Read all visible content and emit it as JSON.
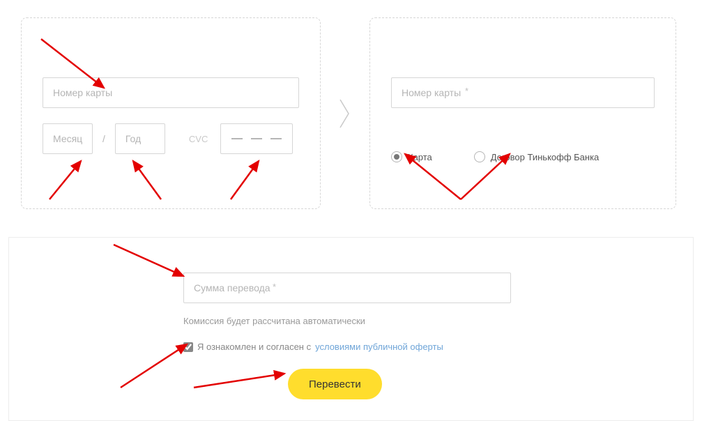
{
  "from_card": {
    "number_placeholder": "Номер карты",
    "month_placeholder": "Месяц",
    "year_placeholder": "Год",
    "cvc_label": "CVC"
  },
  "to_card": {
    "number_placeholder": "Номер карты",
    "radio_card": "Карта",
    "radio_contract": "Договор Тинькофф Банка",
    "selected": "card"
  },
  "transfer": {
    "amount_placeholder": "Сумма перевода",
    "commission_note": "Комиссия будет рассчитана автоматически",
    "consent_text": "Я ознакомлен и согласен с ",
    "consent_link": "условиями публичной оферты",
    "consent_checked": true,
    "submit_label": "Перевести"
  },
  "colors": {
    "accent": "#ffdd2d",
    "link": "#6fa5d8",
    "arrow": "#e30000"
  }
}
